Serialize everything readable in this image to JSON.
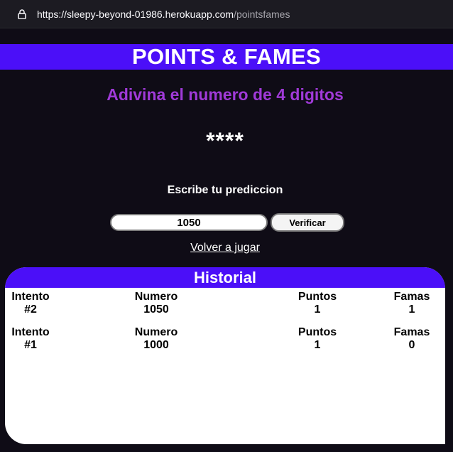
{
  "browser": {
    "url_host": "https://sleepy-beyond-01986.herokuapp.com",
    "url_path": "/pointsfames"
  },
  "header": {
    "title": "POINTS & FAMES"
  },
  "game": {
    "subtitle": "Adivina el numero de 4 digitos",
    "secret_mask": "****",
    "prompt": "Escribe tu prediccion",
    "guess_value": "1050",
    "verify_label": "Verificar",
    "replay_label": "Volver a jugar"
  },
  "history": {
    "title": "Historial",
    "labels": {
      "attempt": "Intento",
      "number": "Numero",
      "points": "Puntos",
      "fames": "Famas"
    },
    "rows": [
      {
        "attempt": "#2",
        "number": "1050",
        "points": "1",
        "fames": "1"
      },
      {
        "attempt": "#1",
        "number": "1000",
        "points": "1",
        "fames": "0"
      }
    ]
  },
  "colors": {
    "accent": "#4b0ff8",
    "subtitle": "#a03ad8",
    "background": "#0f0c16"
  }
}
